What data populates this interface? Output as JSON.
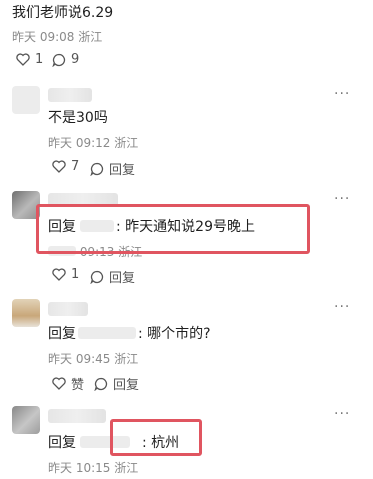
{
  "post": {
    "text": "我们老师说6.29",
    "time": "昨天 09:08",
    "location": "浙江",
    "likes": "1",
    "comments": "9"
  },
  "comments": [
    {
      "text": "不是30吗",
      "time": "昨天 09:12",
      "location": "浙江",
      "likes": "7",
      "reply_label": "回复",
      "more": "···"
    },
    {
      "reply_prefix": "回复",
      "text": "昨天通知说29号晚上",
      "time": "09:13",
      "location": "浙江",
      "likes": "1",
      "reply_label": "回复",
      "more": "···"
    },
    {
      "reply_prefix": "回复",
      "text": "哪个市的?",
      "time": "昨天 09:45",
      "location": "浙江",
      "like_label": "赞",
      "reply_label": "回复",
      "more": "···"
    },
    {
      "reply_prefix": "回复",
      "text": "杭州",
      "time": "昨天 10:15",
      "location": "浙江",
      "more": "···"
    }
  ],
  "colors": {
    "highlight": "#e05560",
    "meta": "#8a8a8a"
  },
  "icons": [
    "heart-icon",
    "comment-bubble-icon",
    "more-icon"
  ]
}
